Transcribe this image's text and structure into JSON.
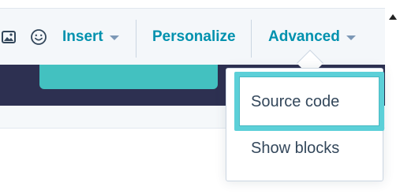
{
  "toolbar": {
    "icons": {
      "image": "image-icon",
      "emoji": "emoji-icon"
    },
    "insert_label": "Insert",
    "personalize_label": "Personalize",
    "advanced_label": "Advanced"
  },
  "advanced_menu": {
    "items": [
      {
        "label": "Source code",
        "highlighted": true
      },
      {
        "label": "Show blocks",
        "highlighted": false
      }
    ]
  },
  "colors": {
    "accent": "#0091ae",
    "text": "#33475b",
    "highlight_border": "#5cd0d8",
    "dark_strip": "#2d3051",
    "teal_block": "#43c1c0"
  }
}
